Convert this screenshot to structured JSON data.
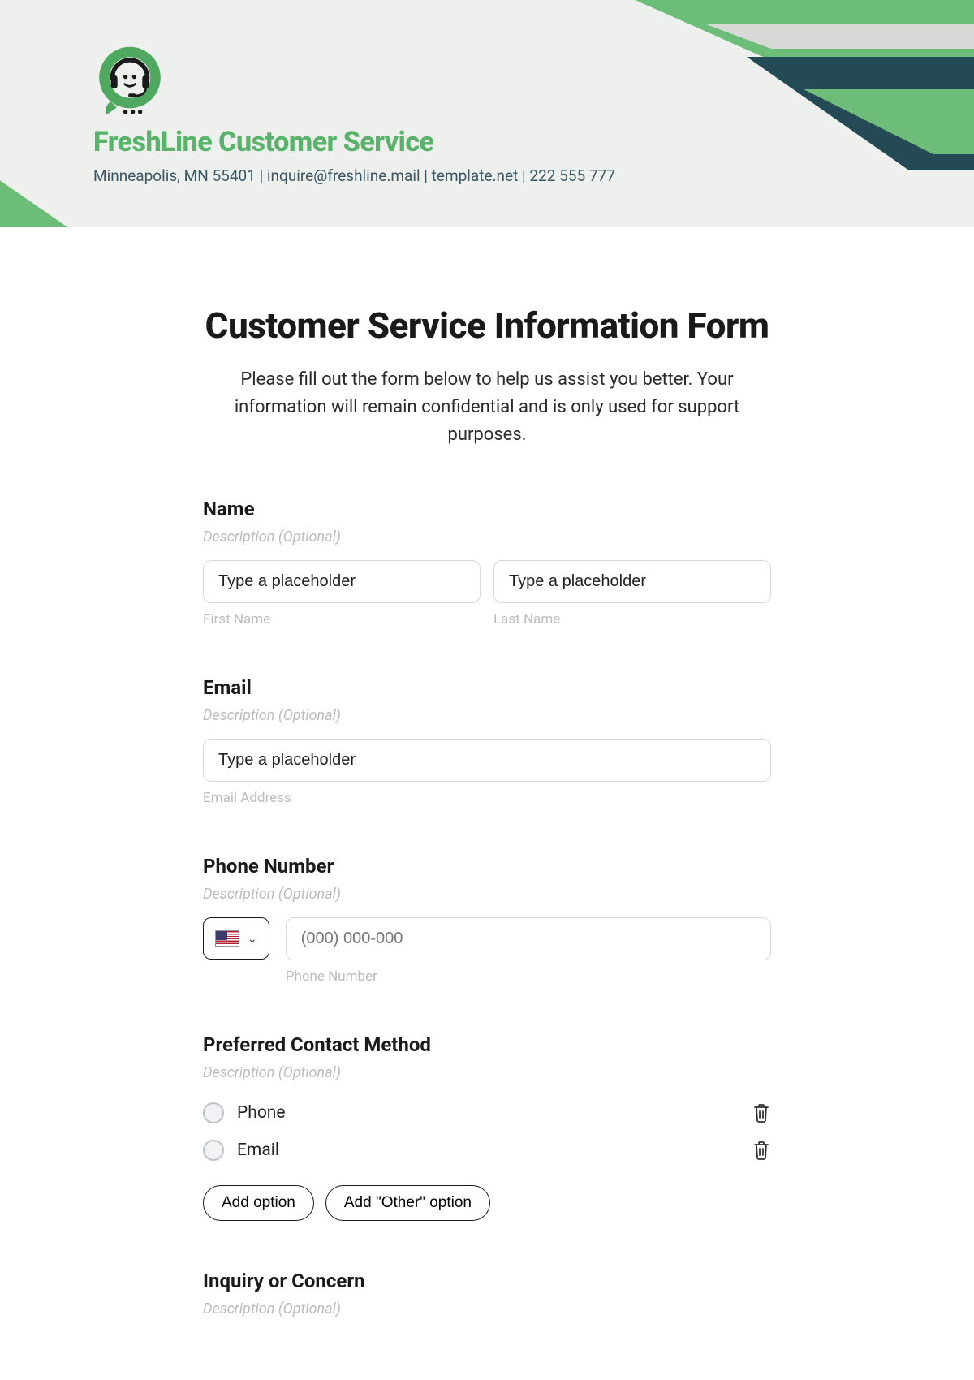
{
  "header": {
    "company_name": "FreshLine Customer Service",
    "subline": "Minneapolis, MN 55401 | inquire@freshline.mail | template.net | 222 555 777"
  },
  "form": {
    "title": "Customer Service Information Form",
    "intro": "Please fill out the form below to help us assist you better. Your information will remain confidential and is only used for support purposes."
  },
  "name": {
    "label": "Name",
    "desc": "Description (Optional)",
    "first_placeholder": "Type a placeholder",
    "last_placeholder": "Type a placeholder",
    "first_sub": "First Name",
    "last_sub": "Last Name"
  },
  "email": {
    "label": "Email",
    "desc": "Description (Optional)",
    "placeholder": "Type a placeholder",
    "sub": "Email Address"
  },
  "phone": {
    "label": "Phone Number",
    "desc": "Description (Optional)",
    "placeholder": "(000) 000-000",
    "sub": "Phone Number"
  },
  "contact_method": {
    "label": "Preferred Contact Method",
    "desc": "Description (Optional)",
    "options": [
      "Phone",
      "Email"
    ],
    "add_option": "Add option",
    "add_other": "Add \"Other\" option"
  },
  "inquiry": {
    "label": "Inquiry or Concern",
    "desc": "Description (Optional)"
  }
}
